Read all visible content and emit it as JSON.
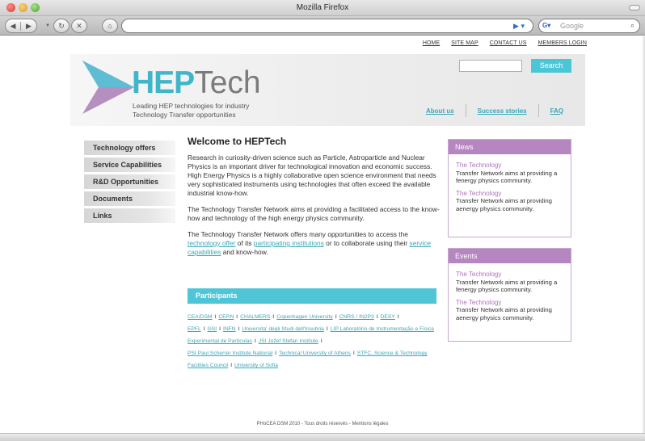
{
  "browser": {
    "window_title": "Mozilla Firefox",
    "search_placeholder": "Google"
  },
  "colors": {
    "accent_teal": "#4fc5d6",
    "box_purple": "#b586bf"
  },
  "top_links": [
    "HOME",
    "SITE MAP",
    "CONTACT US",
    "MEMBERS LOGIN"
  ],
  "banner": {
    "logo_bold": "HEP",
    "logo_light": "Tech",
    "tagline_line1": "Leading HEP technologies for industry",
    "tagline_line2": "Technology Transfer opportunities",
    "search_button": "Search",
    "links": [
      "About us",
      "Success stories",
      "FAQ"
    ]
  },
  "sidebar": {
    "items": [
      {
        "label": "Technology offers"
      },
      {
        "label": "Service Capabilities"
      },
      {
        "label": "R&D Opportunities"
      },
      {
        "label": "Documents"
      },
      {
        "label": "Links"
      }
    ]
  },
  "main": {
    "title": "Welcome to HEPTech",
    "paragraph1": "Research in curiosity-driven science such as Particle, Astroparticle and Nuclear Physics is an important driver for technological innovation and economic success. High Energy Physics is a highly collaborative open science environment that needs very sophisticated instruments using technologies that often exceed the available industrial know-how.",
    "paragraph2": "The Technology Transfer Network aims at providing a facilitated access to the know-how and technology of the high energy physics community.",
    "p3_start": "The Technology Transfer Network offers many opportunities to access the ",
    "p3_link1": "technology offer",
    "p3_mid1": " of its ",
    "p3_link2": "participating institutions",
    "p3_mid2": " or to collaborate using their ",
    "p3_link3": "service capabilities",
    "p3_end": " and know-how.",
    "participants_title": "Participants",
    "participants": [
      "CEA/DSM",
      "CERN",
      "CHALMERS",
      "Copenhagen University",
      "CNRS / IN2P3",
      "DESY",
      "EPFL",
      "GSI",
      "INFN",
      "Universita' degli Studi dell'Insubria",
      "LIP Laboratório de Instrumentação e Física Experimental de Partículas",
      "JSI Jožef Stefan Institute",
      "PSI Paul Scherrer Institute National",
      "Technical University of Athens",
      "STFC, Science & Technology Facilities Council",
      "University of Sofia"
    ]
  },
  "news": {
    "title": "News",
    "items": [
      {
        "title": "The Technology",
        "text": "Transfer Network aims at providing a fenergy physics community."
      },
      {
        "title": "The Technology",
        "text": "Transfer Network aims at providing aenergy physics community."
      }
    ]
  },
  "events": {
    "title": "Events",
    "items": [
      {
        "title": "The Technology",
        "text": "Transfer Network aims at providing a fenergy physics community."
      },
      {
        "title": "The Technology",
        "text": "Transfer Network aims at providing aenergy physics community."
      }
    ]
  },
  "footer": "PHoCEA DSM 2010 - Tous droits réservés - Mentions légales"
}
